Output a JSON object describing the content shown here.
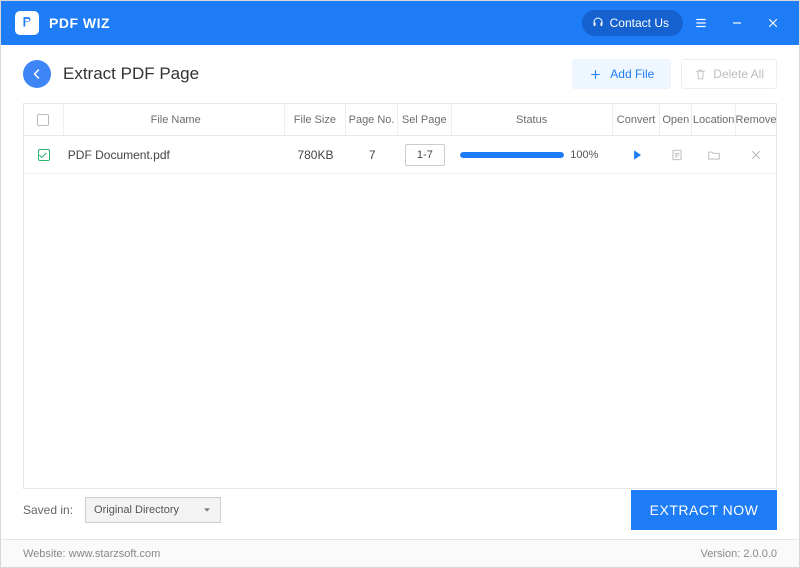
{
  "titlebar": {
    "app_name": "PDF WIZ",
    "contact_label": "Contact Us"
  },
  "subhead": {
    "page_title": "Extract PDF Page",
    "add_file_label": "Add File",
    "delete_all_label": "Delete All"
  },
  "columns": {
    "file_name": "File Name",
    "file_size": "File Size",
    "page_no": "Page No.",
    "sel_page": "Sel Page",
    "status": "Status",
    "convert": "Convert",
    "open": "Open",
    "location": "Location",
    "remove": "Remove"
  },
  "rows": [
    {
      "checked": true,
      "file_name": "PDF Document.pdf",
      "file_size": "780KB",
      "page_no": "7",
      "sel_page": "1-7",
      "progress_pct": 100,
      "status_text": "100%"
    }
  ],
  "bottom": {
    "saved_label": "Saved in:",
    "save_directory": "Original Directory",
    "extract_label": "EXTRACT NOW"
  },
  "footer": {
    "website_label": "Website: www.starzsoft.com",
    "version_label": "Version: 2.0.0.0"
  }
}
